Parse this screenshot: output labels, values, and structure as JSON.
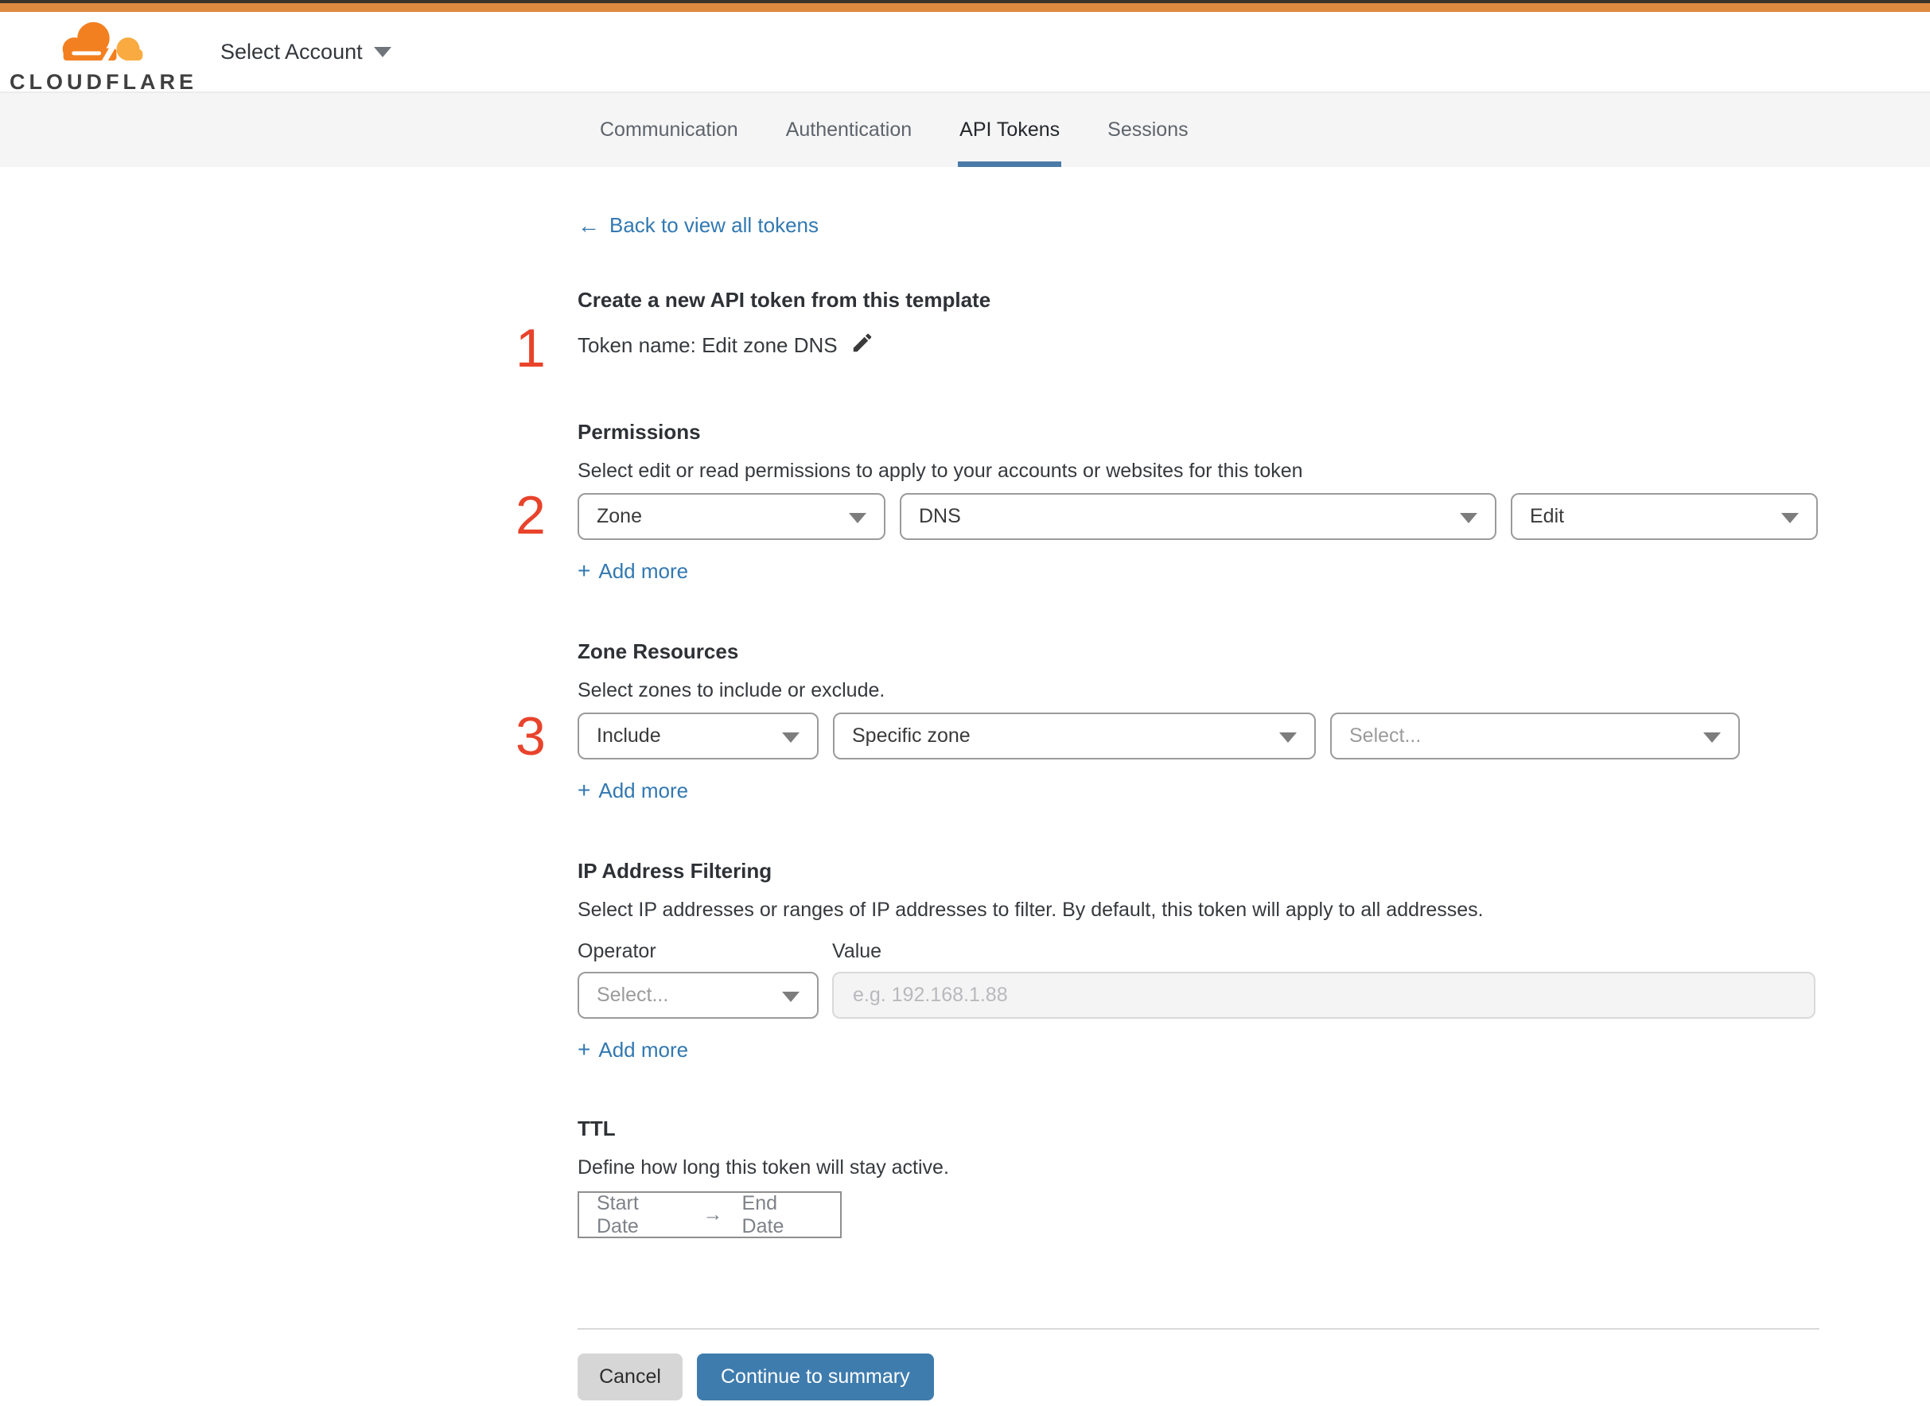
{
  "header": {
    "logo": "CLOUDFLARE",
    "account_selector": "Select Account"
  },
  "tabs": [
    {
      "label": "Communication"
    },
    {
      "label": "Authentication"
    },
    {
      "label": "API Tokens"
    },
    {
      "label": "Sessions"
    }
  ],
  "back": {
    "arrow": "←",
    "label": "Back to view all tokens"
  },
  "create": {
    "title": "Create a new API token from this template",
    "token_name": "Token name: Edit zone DNS"
  },
  "annotations": {
    "m1": "1",
    "m2": "2",
    "m3": "3"
  },
  "permissions": {
    "title": "Permissions",
    "description": "Select edit or read permissions to apply to your accounts or websites for this token",
    "scope": "Zone",
    "resource": "DNS",
    "access": "Edit"
  },
  "zone_resources": {
    "title": "Zone Resources",
    "description": "Select zones to include or exclude.",
    "mode": "Include",
    "type": "Specific zone",
    "zone_placeholder": "Select..."
  },
  "ip_filtering": {
    "title": "IP Address Filtering",
    "description": "Select IP addresses or ranges of IP addresses to filter. By default, this token will apply to all addresses.",
    "operator_label": "Operator",
    "value_label": "Value",
    "operator_placeholder": "Select...",
    "value_placeholder": "e.g. 192.168.1.88"
  },
  "ttl": {
    "title": "TTL",
    "description": "Define how long this token will stay active.",
    "start": "Start Date",
    "arrow": "→",
    "end": "End Date"
  },
  "ui": {
    "add_more_plus": "+",
    "add_more_label": "Add more"
  },
  "footer": {
    "cancel": "Cancel",
    "continue": "Continue to summary"
  },
  "colors": {
    "brand_orange": "#f38020",
    "brand_orange_light": "#f9ab41",
    "topbar_orange": "#de8a3f",
    "link_blue": "#3278b1",
    "active_tab_underline": "#4a7aa8",
    "primary_button_blue": "#3f7cae",
    "marker_red": "#e8432b"
  }
}
